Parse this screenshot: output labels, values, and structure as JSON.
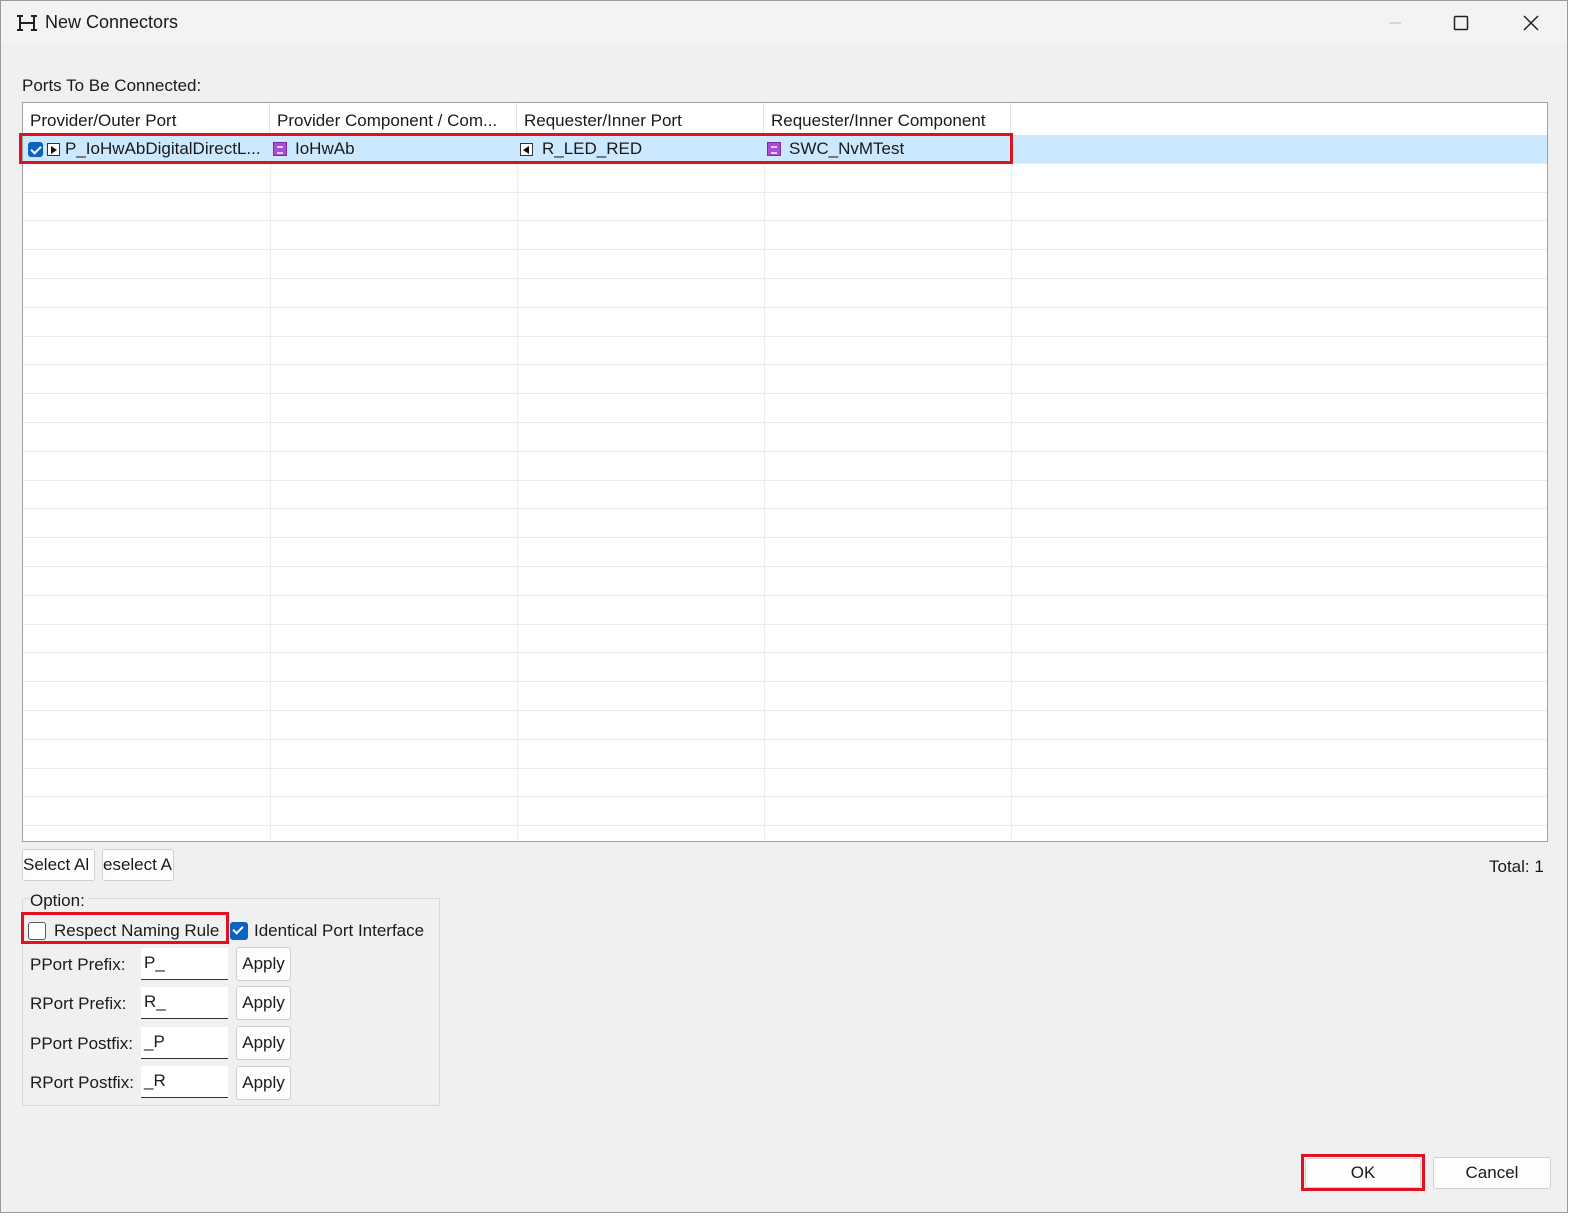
{
  "window": {
    "title": "New Connectors",
    "minimize_label": "—",
    "maximize_label": "☐",
    "close_label": "✕"
  },
  "section_label": "Ports To Be Connected:",
  "table": {
    "columns": [
      "Provider/Outer Port",
      "Provider Component / Com...",
      "Requester/Inner Port",
      "Requester/Inner Component"
    ],
    "rows": [
      {
        "checked": true,
        "provider_port": "P_IoHwAbDigitalDirectL...",
        "provider_component": "IoHwAb",
        "requester_port": "R_LED_RED",
        "requester_component": "SWC_NvMTest"
      }
    ]
  },
  "buttons": {
    "select_all": "Select Al",
    "deselect_all": "eselect A",
    "ok": "OK",
    "cancel": "Cancel"
  },
  "total_label": "Total: 1",
  "options": {
    "legend": "Option:",
    "respect_naming_rule": {
      "label": "Respect Naming Rule",
      "checked": false
    },
    "identical_port_interface": {
      "label": "Identical Port Interface",
      "checked": true
    },
    "fields": [
      {
        "label": "PPort Prefix:",
        "value": "P_",
        "apply": "Apply"
      },
      {
        "label": "RPort Prefix:",
        "value": "R_",
        "apply": "Apply"
      },
      {
        "label": "PPort Postfix:",
        "value": "_P",
        "apply": "Apply"
      },
      {
        "label": "RPort Postfix:",
        "value": "_R",
        "apply": "Apply"
      }
    ]
  },
  "colors": {
    "highlight": "#e0121f",
    "selection": "#cce8ff",
    "checkbox": "#0b64c0",
    "component_icon": "#a64fd6"
  }
}
